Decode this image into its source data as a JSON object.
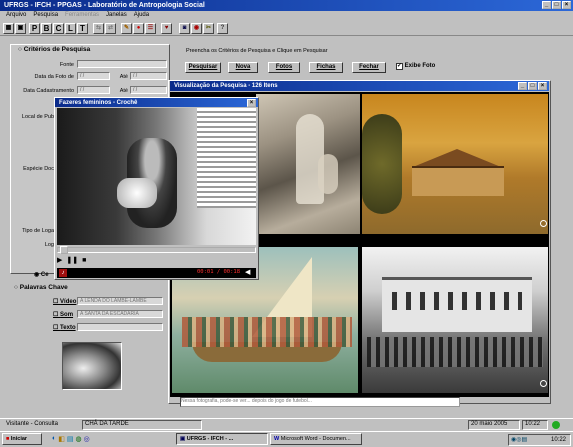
{
  "app": {
    "title": "UFRGS - IFCH - PPGAS - Laboratório de Antropologia Social",
    "menu": [
      "Arquivo",
      "Pesquisa",
      "Ferramentas",
      "Janelas",
      "Ajuda"
    ],
    "toolbar_letters": [
      "P",
      "B",
      "C",
      "L",
      "T"
    ]
  },
  "criteria": {
    "header": "Critérios de Pesquisa",
    "fonte_label": "Fonte",
    "data_foto_label": "Data da Foto de",
    "data_cadastro_label": "Data Cadastramento",
    "ate_label": "Até",
    "local_label": "Local de Pub",
    "especie_label": "Espécie Doc",
    "tipo_label": "Tipo de Loga",
    "log_label": "Log",
    "date_placeholder": "/ /"
  },
  "instructions": "Preencha os Critérios de Pesquisa e Clique em Pesquisar",
  "actions": {
    "pesquisar": "Pesquisar",
    "nova": "Nova",
    "fotos": "Fotos",
    "fichas": "Fichas",
    "fechar": "Fechar",
    "exibe_foto": "Exibe Foto"
  },
  "keywords": {
    "header": "Palavras Chave",
    "video_label": "Vídeo",
    "video_value": "A LENDA DO LAMBE-LAMBE",
    "som_label": "Som",
    "som_value": "A SANTA DA ESCADARIA",
    "texto_label": "Texto"
  },
  "viewer": {
    "title": "Visualização da Pesquisa - 126 Itens"
  },
  "video": {
    "title": "Fazeres femininos - Crochê",
    "time": "00:01 / 00:18"
  },
  "statusbar": {
    "user": "Visitante - Consulta",
    "current": "CHÁ DA TARDE",
    "date": "20 maio 2005",
    "time": "10:22"
  },
  "bottom_strip": "Nessa fotografia, pode-se ver... depois do jogo de futebol...",
  "taskbar": {
    "start": "Iniciar",
    "items": [
      "UFRGS - IFCH - ...",
      "Microsoft Word - Documen..."
    ],
    "clock": "10:22"
  },
  "colors": {
    "titlebar": "#0a2a8a",
    "window_bg": "#c0c0c0",
    "video_bar": "#a01010",
    "time_text": "#ff3030"
  }
}
